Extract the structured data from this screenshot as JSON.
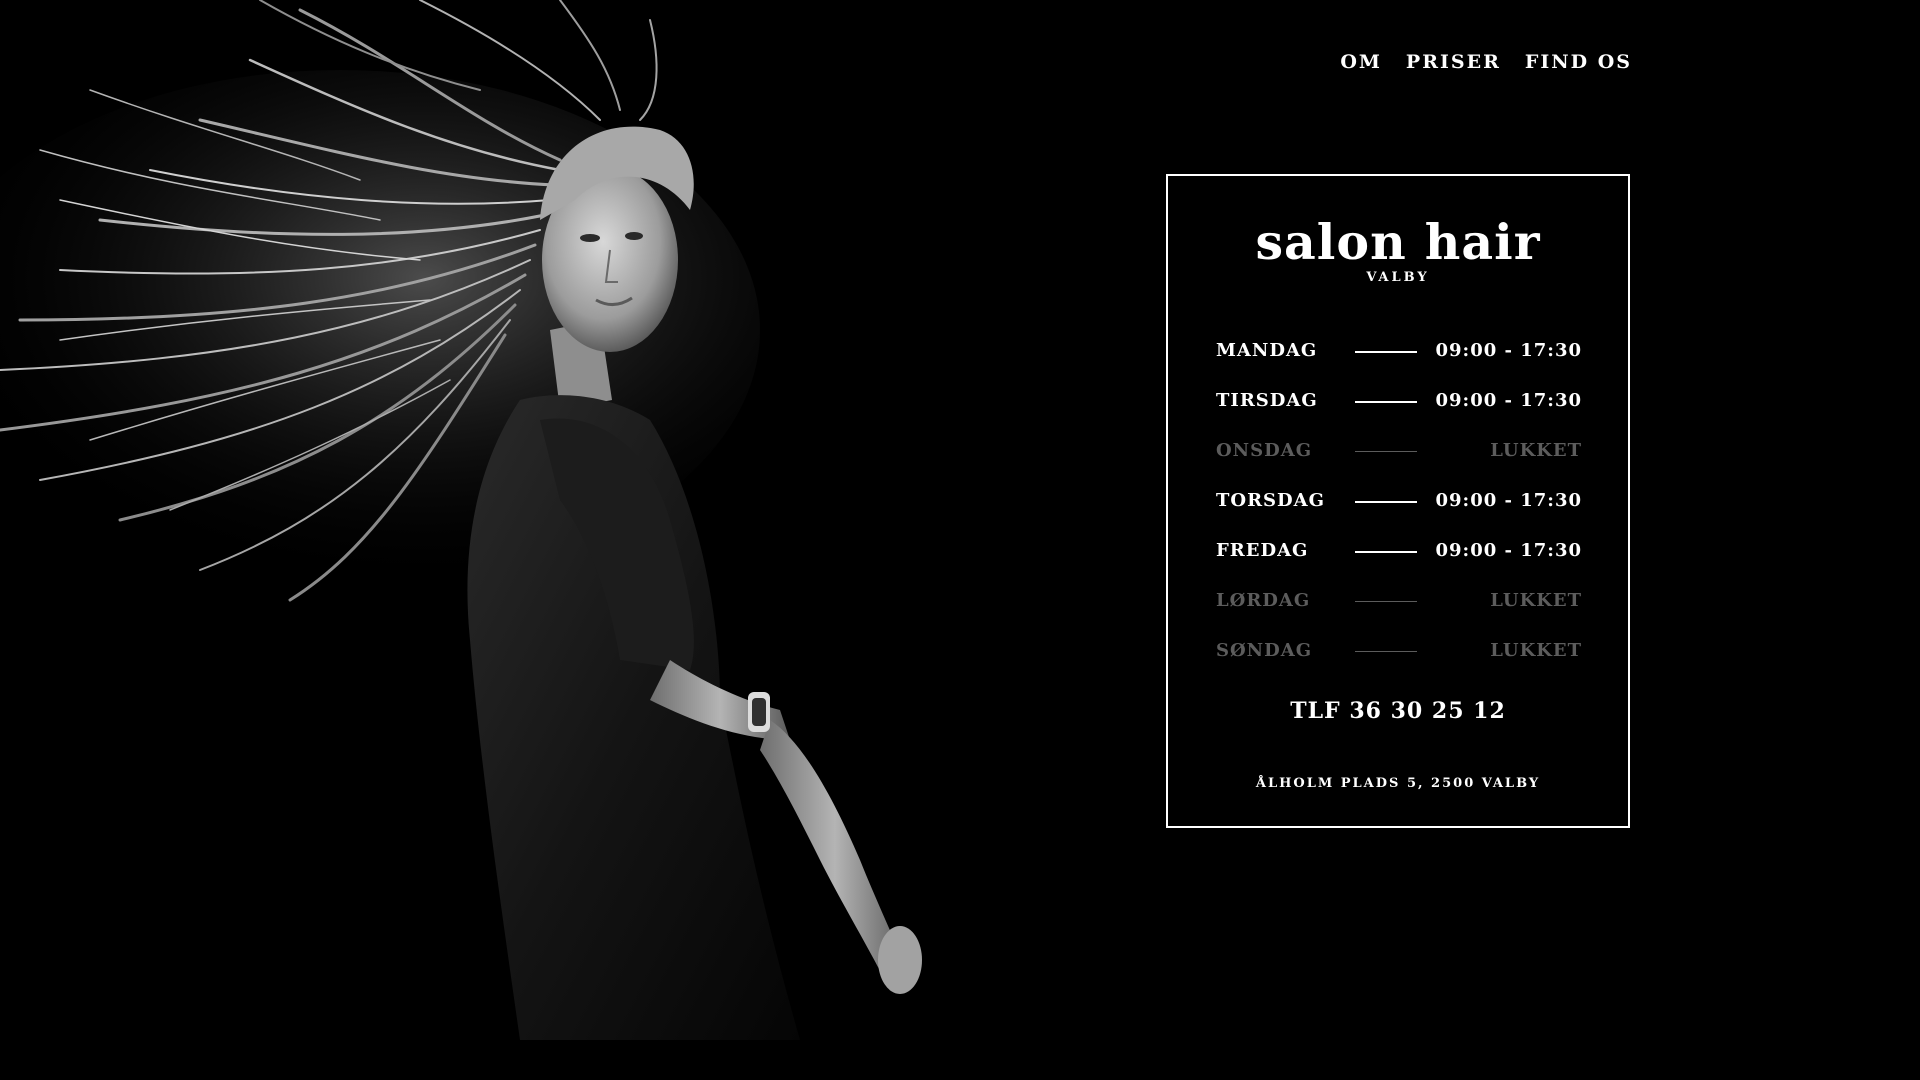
{
  "nav": {
    "items": [
      {
        "label": "OM"
      },
      {
        "label": "PRISER"
      },
      {
        "label": "FIND OS"
      }
    ]
  },
  "card": {
    "brand": "salon hair",
    "location": "VALBY",
    "hours": [
      {
        "day": "MANDAG",
        "time": "09:00 - 17:30",
        "closed": false
      },
      {
        "day": "TIRSDAG",
        "time": "09:00 - 17:30",
        "closed": false
      },
      {
        "day": "ONSDAG",
        "time": "LUKKET",
        "closed": true
      },
      {
        "day": "TORSDAG",
        "time": "09:00 - 17:30",
        "closed": false
      },
      {
        "day": "FREDAG",
        "time": "09:00 - 17:30",
        "closed": false
      },
      {
        "day": "LØRDAG",
        "time": "LUKKET",
        "closed": true
      },
      {
        "day": "SØNDAG",
        "time": "LUKKET",
        "closed": true
      }
    ],
    "phone": "TLF 36 30 25 12",
    "address": "ÅLHOLM PLADS 5, 2500 VALBY"
  },
  "colors": {
    "background": "#000000",
    "text": "#ffffff",
    "closed_text": "#5c5c5c"
  }
}
